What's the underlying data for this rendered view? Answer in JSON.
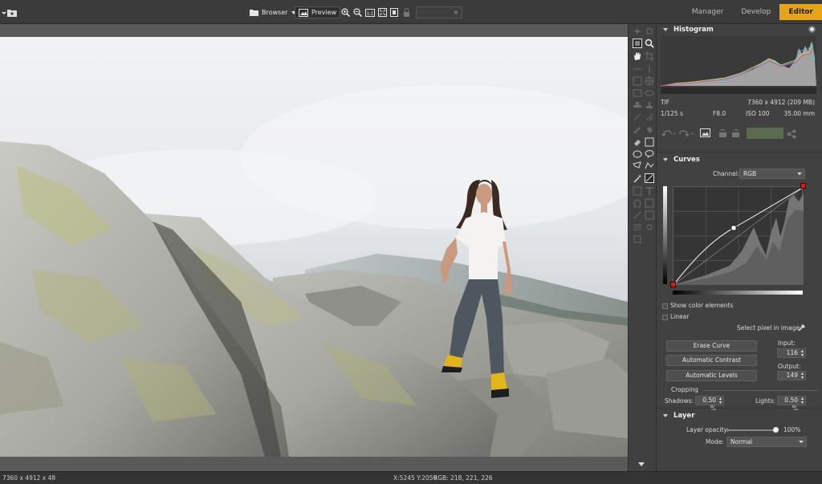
{
  "toolbar": {
    "browser_label": "Browser",
    "preview_label": "Preview"
  },
  "modes": [
    "Manager",
    "Develop",
    "Editor"
  ],
  "photo": {
    "icons": [
      "hand-icon",
      "zoom-icon"
    ]
  },
  "histogram": {
    "title": "Histogram",
    "file_type": "TIF",
    "dimensions": "7360 x 4912 (209 MB)",
    "shutter": "1/125 s",
    "aperture": "F8.0",
    "iso": "ISO 100",
    "focal": "35.00 mm"
  },
  "curves": {
    "title": "Curves",
    "channel_label": "Channel:",
    "channel_value": "RGB",
    "show_color_label": "Show color elements",
    "linear_label": "Linear",
    "select_pixel_label": "Select pixel in image:",
    "erase_label": "Erase Curve",
    "auto_contrast_label": "Automatic Contrast",
    "auto_levels_label": "Automatic Levels",
    "input_label": "Input:",
    "input_value": "116",
    "output_label": "Output:",
    "output_value": "149",
    "cropping_label": "Cropping",
    "shadows_label": "Shadows:",
    "shadows_value": "0.50 %",
    "lights_label": "Lights:",
    "lights_value": "0.50 %"
  },
  "layer": {
    "title": "Layer",
    "opacity_label": "Layer opacity:",
    "opacity_value": "100%",
    "opacity_fraction": 1.0,
    "mode_label": "Mode:",
    "mode_value": "Normal"
  },
  "status": {
    "image_info": "7360 x 4912 x 48",
    "coords": "X:5245 Y:2059",
    "rgb": "RGB: 218, 221, 226"
  },
  "colors": {
    "accent": "#e8a317",
    "curve_point": "#d01f1f"
  }
}
